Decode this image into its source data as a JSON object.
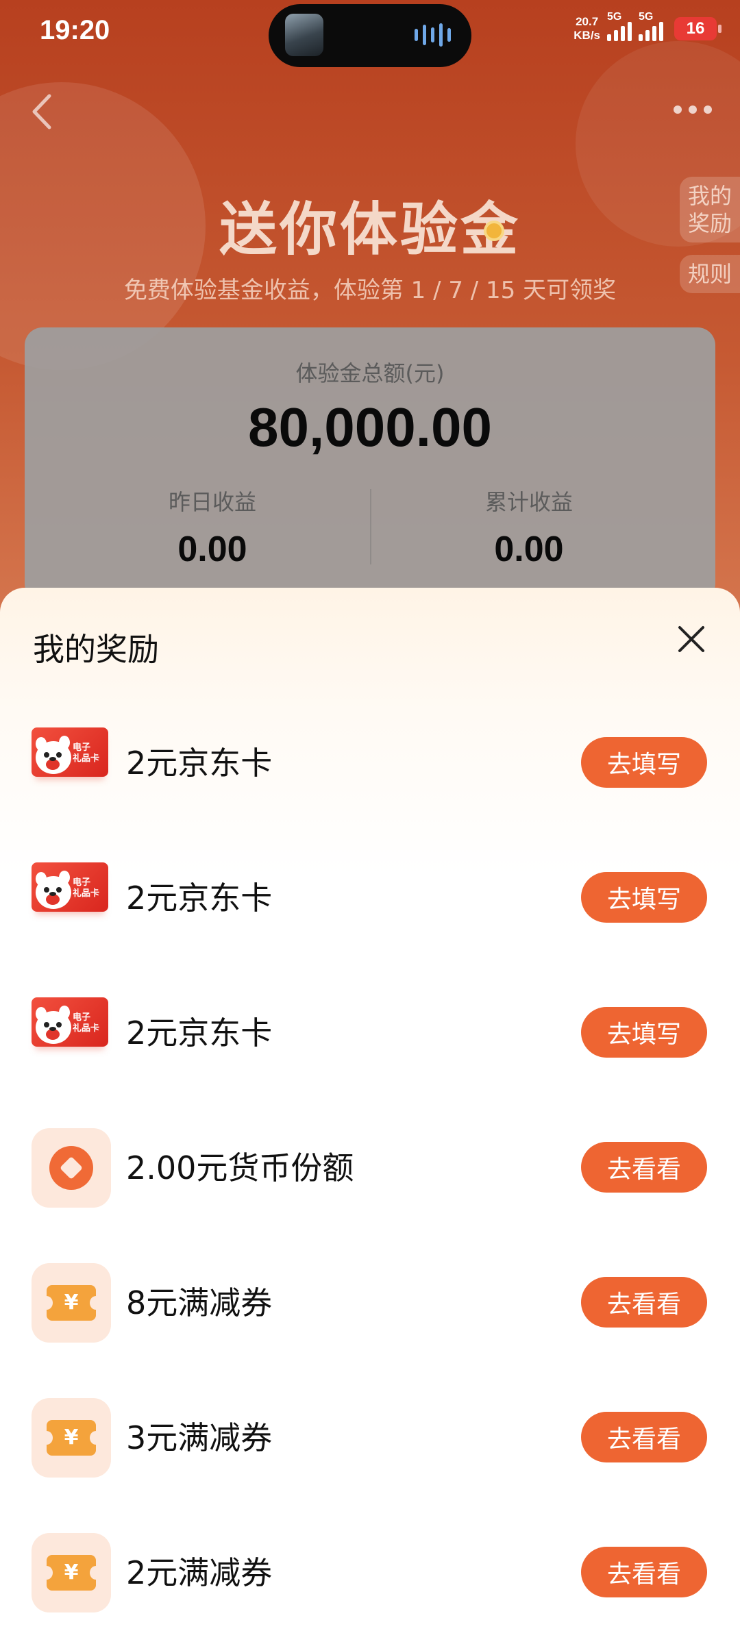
{
  "status_bar": {
    "time": "19:20",
    "net_speed_value": "20.7",
    "net_speed_unit": "KB/s",
    "signal_1": "5G",
    "signal_2": "5G",
    "battery": "16"
  },
  "hero": {
    "title": "送你体验金",
    "subtitle": "免费体验基金收益，体验第 1 / 7 / 15 天可领奖",
    "side_reward": "我的奖励",
    "side_rules": "规则"
  },
  "card": {
    "total_label": "体验金总额(元)",
    "total_value": "80,000.00",
    "yesterday_label": "昨日收益",
    "yesterday_value": "0.00",
    "cumulative_label": "累计收益",
    "cumulative_value": "0.00"
  },
  "sheet": {
    "title": "我的奖励",
    "rewards": [
      {
        "name": "2元京东卡",
        "button": "去填写",
        "icon": "jd-gift-card-icon"
      },
      {
        "name": "2元京东卡",
        "button": "去填写",
        "icon": "jd-gift-card-icon"
      },
      {
        "name": "2元京东卡",
        "button": "去填写",
        "icon": "jd-gift-card-icon"
      },
      {
        "name": "2.00元货币份额",
        "button": "去看看",
        "icon": "coin-icon"
      },
      {
        "name": "8元满减券",
        "button": "去看看",
        "icon": "coupon-icon"
      },
      {
        "name": "3元满减券",
        "button": "去看看",
        "icon": "coupon-icon"
      },
      {
        "name": "2元满减券",
        "button": "去看看",
        "icon": "coupon-icon"
      }
    ]
  },
  "icons": {
    "jd_card_text_1": "电子",
    "jd_card_text_2": "礼品卡",
    "coupon_symbol": "¥"
  },
  "colors": {
    "accent": "#ee6532",
    "header_bg": "#b7401f"
  }
}
